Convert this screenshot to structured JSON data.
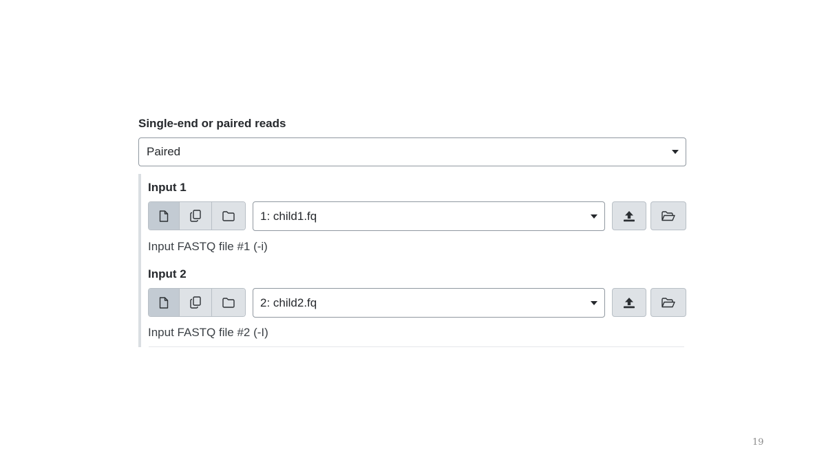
{
  "reads": {
    "label": "Single-end or paired reads",
    "selected": "Paired"
  },
  "inputs": [
    {
      "title": "Input 1",
      "selected": "1: child1.fq",
      "help": "Input FASTQ file #1 (-i)"
    },
    {
      "title": "Input 2",
      "selected": "2: child2.fq",
      "help": "Input FASTQ file #2 (-I)"
    }
  ],
  "icons": {
    "single": "file-icon",
    "multiple": "copy-icon",
    "collection": "folder-icon",
    "upload": "upload-icon",
    "browse": "folder-open-icon"
  },
  "page_number": "19"
}
